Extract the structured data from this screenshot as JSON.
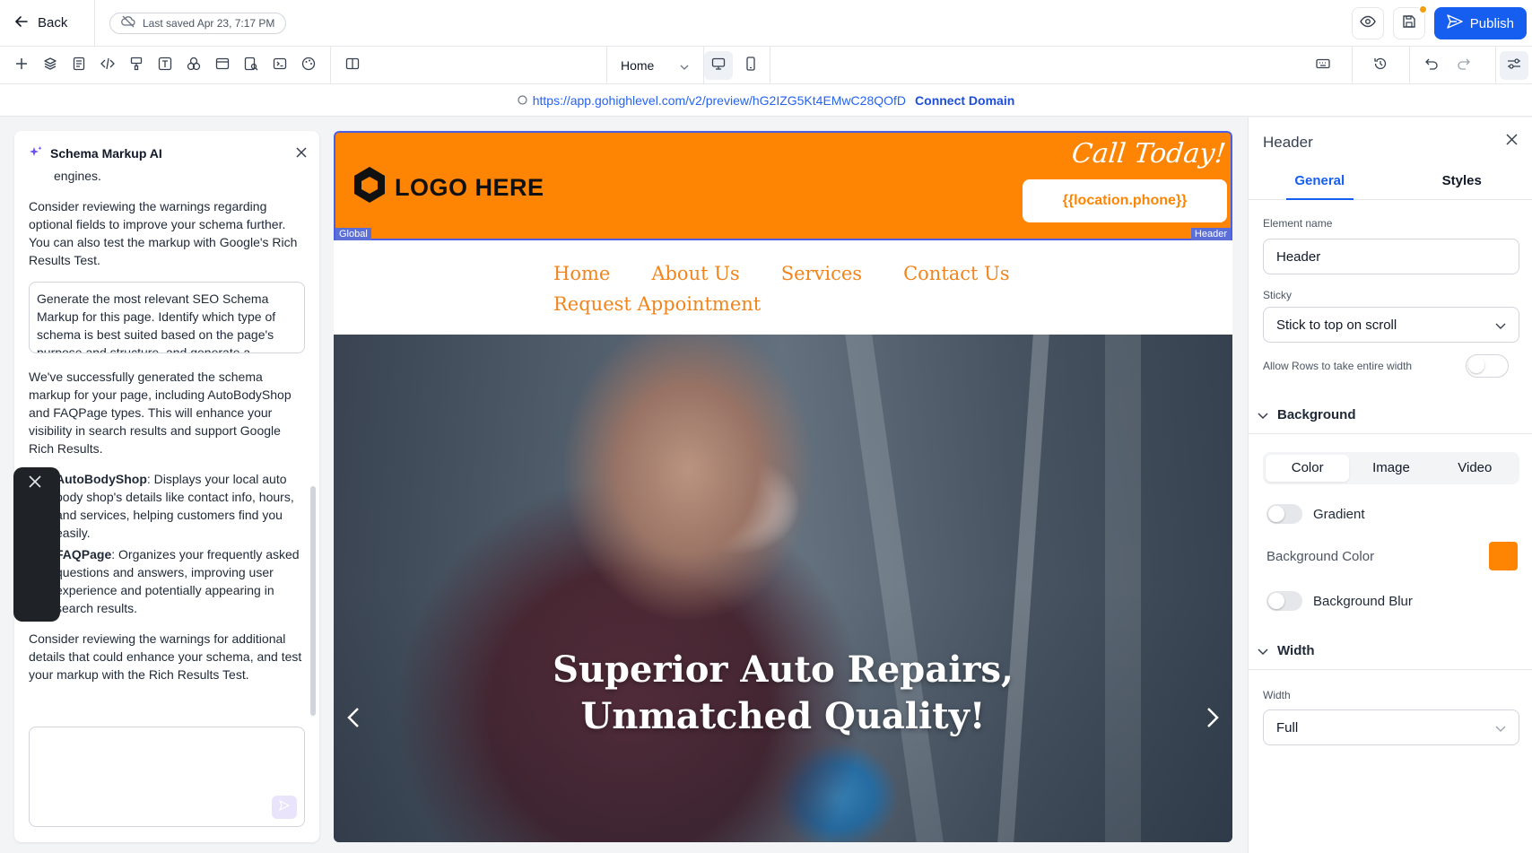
{
  "topbar": {
    "back_label": "Back",
    "saved_text": "Last saved Apr 23, 7:17 PM",
    "publish_label": "Publish"
  },
  "toolbar": {
    "page_select": "Home"
  },
  "urlbar": {
    "preview_url": "https://app.gohighlevel.com/v2/preview/hG2IZG5Kt4EMwC28QOfD",
    "connect_domain": "Connect Domain"
  },
  "ai_panel": {
    "title": "Schema Markup AI",
    "frag": "engines.",
    "para1": "Consider reviewing the warnings regarding optional fields to improve your schema further. You can also test the markup with Google's Rich Results Test.",
    "prompt": "Generate the most relevant SEO Schema Markup for this page. Identify which type of schema is best suited based on the page's purpose and structure, and generate a",
    "para2": "We've successfully generated the schema markup for your page, including AutoBodyShop and FAQPage types. This will enhance your visibility in search results and support Google Rich Results.",
    "items": [
      {
        "name": "AutoBodyShop",
        "desc": ": Displays your local auto body shop's details like contact info, hours, and services, helping customers find you easily."
      },
      {
        "name": "FAQPage",
        "desc": ": Organizes your frequently asked questions and answers, improving user experience and potentially appearing in search results."
      }
    ],
    "para3": "Consider reviewing the warnings for additional details that could enhance your schema, and test your markup with the Rich Results Test."
  },
  "site": {
    "logo_text": "LOGO HERE",
    "call_today": "Call Today!",
    "phone": "{{location.phone}}",
    "tag_global": "Global",
    "tag_header": "Header",
    "nav": [
      "Home",
      "About Us",
      "Services",
      "Contact Us",
      "Request Appointment"
    ],
    "hero_line1": "Superior Auto Repairs,",
    "hero_line2": "Unmatched Quality!"
  },
  "settings": {
    "title": "Header",
    "tabs": [
      "General",
      "Styles"
    ],
    "element_name_label": "Element name",
    "element_name_value": "Header",
    "sticky_label": "Sticky",
    "sticky_value": "Stick to top on scroll",
    "allow_rows_label": "Allow Rows to take entire width",
    "background_section": "Background",
    "bg_tabs": [
      "Color",
      "Image",
      "Video"
    ],
    "gradient_label": "Gradient",
    "bg_color_label": "Background Color",
    "bg_color": "#fe8503",
    "bg_blur_label": "Background Blur",
    "width_section": "Width",
    "width_label": "Width",
    "width_value": "Full"
  },
  "colors": {
    "accent": "#155eef",
    "brand_orange": "#fe8503",
    "nav_orange": "#f0851e"
  }
}
